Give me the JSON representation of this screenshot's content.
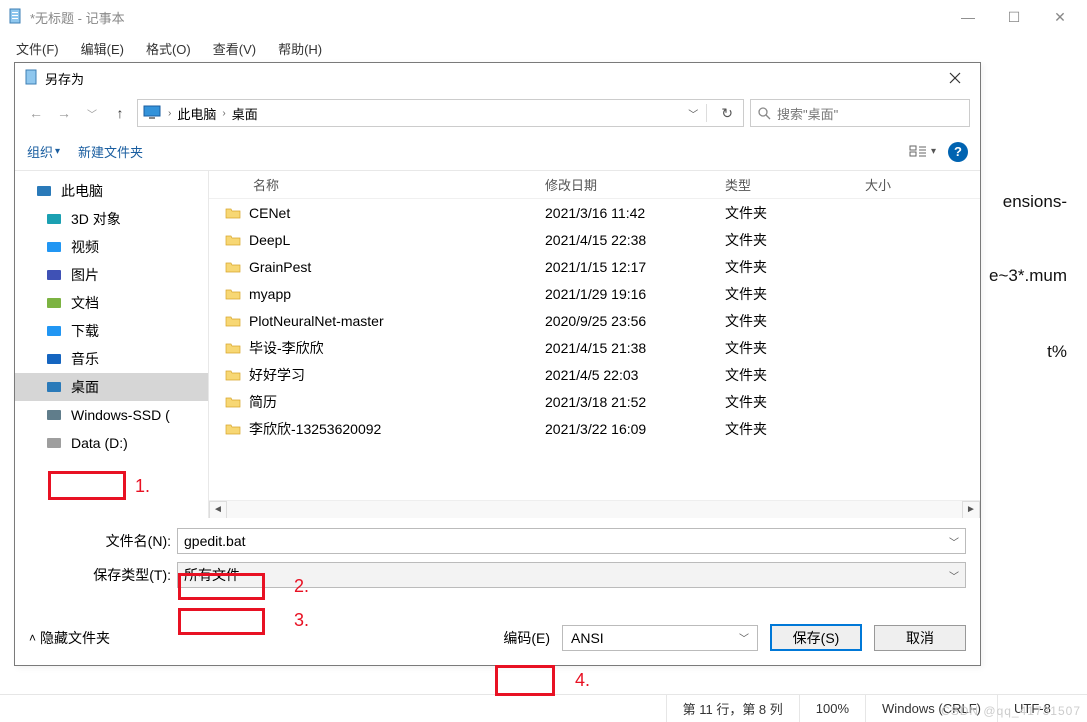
{
  "notepad": {
    "title": "*无标题 - 记事本",
    "menu": {
      "file": "文件(F)",
      "edit": "编辑(E)",
      "format": "格式(O)",
      "view": "查看(V)",
      "help": "帮助(H)"
    },
    "bg1": "ensions-",
    "bg2": "e~3*.mum",
    "bg3": "t%",
    "watermark": "CSDN @qq_41731507"
  },
  "status": {
    "pos": "第 11 行，第 8 列",
    "zoom": "100%",
    "eol": "Windows (CRLF)",
    "enc": "UTF-8"
  },
  "dialog": {
    "title": "另存为",
    "breadcrumb": {
      "pc": "此电脑",
      "desktop": "桌面"
    },
    "search_placeholder": "搜索\"桌面\"",
    "organize": "组织",
    "new_folder": "新建文件夹",
    "tree": [
      "此电脑",
      "3D 对象",
      "视频",
      "图片",
      "文档",
      "下载",
      "音乐",
      "桌面",
      "Windows-SSD (",
      "Data (D:)"
    ],
    "columns": {
      "name": "名称",
      "date": "修改日期",
      "type": "类型",
      "size": "大小"
    },
    "files": [
      {
        "name": "CENet",
        "date": "2021/3/16 11:42",
        "type": "文件夹"
      },
      {
        "name": "DeepL",
        "date": "2021/4/15 22:38",
        "type": "文件夹"
      },
      {
        "name": "GrainPest",
        "date": "2021/1/15 12:17",
        "type": "文件夹"
      },
      {
        "name": "myapp",
        "date": "2021/1/29 19:16",
        "type": "文件夹"
      },
      {
        "name": "PlotNeuralNet-master",
        "date": "2020/9/25 23:56",
        "type": "文件夹"
      },
      {
        "name": "毕设-李欣欣",
        "date": "2021/4/15 21:38",
        "type": "文件夹"
      },
      {
        "name": "好好学习",
        "date": "2021/4/5 22:03",
        "type": "文件夹"
      },
      {
        "name": "简历",
        "date": "2021/3/18 21:52",
        "type": "文件夹"
      },
      {
        "name": "李欣欣-13253620092",
        "date": "2021/3/22 16:09",
        "type": "文件夹"
      }
    ],
    "filename_label": "文件名(N):",
    "filename_value": "gpedit.bat",
    "filetype_label": "保存类型(T):",
    "filetype_value": "所有文件",
    "hide_folders": "隐藏文件夹",
    "encoding_label": "编码(E)",
    "encoding_value": "ANSI",
    "save_btn": "保存(S)",
    "cancel_btn": "取消"
  },
  "annotations": {
    "a1": "1.",
    "a2": "2.",
    "a3": "3.",
    "a4": "4."
  },
  "icons": {
    "tree_hues": [
      "#2a7ab9",
      "#1ba0b2",
      "#2196f3",
      "#3f51b5",
      "#7cb342",
      "#2196f3",
      "#1565c0",
      "#2a7ab9",
      "#607d8b",
      "#9e9e9e"
    ]
  }
}
